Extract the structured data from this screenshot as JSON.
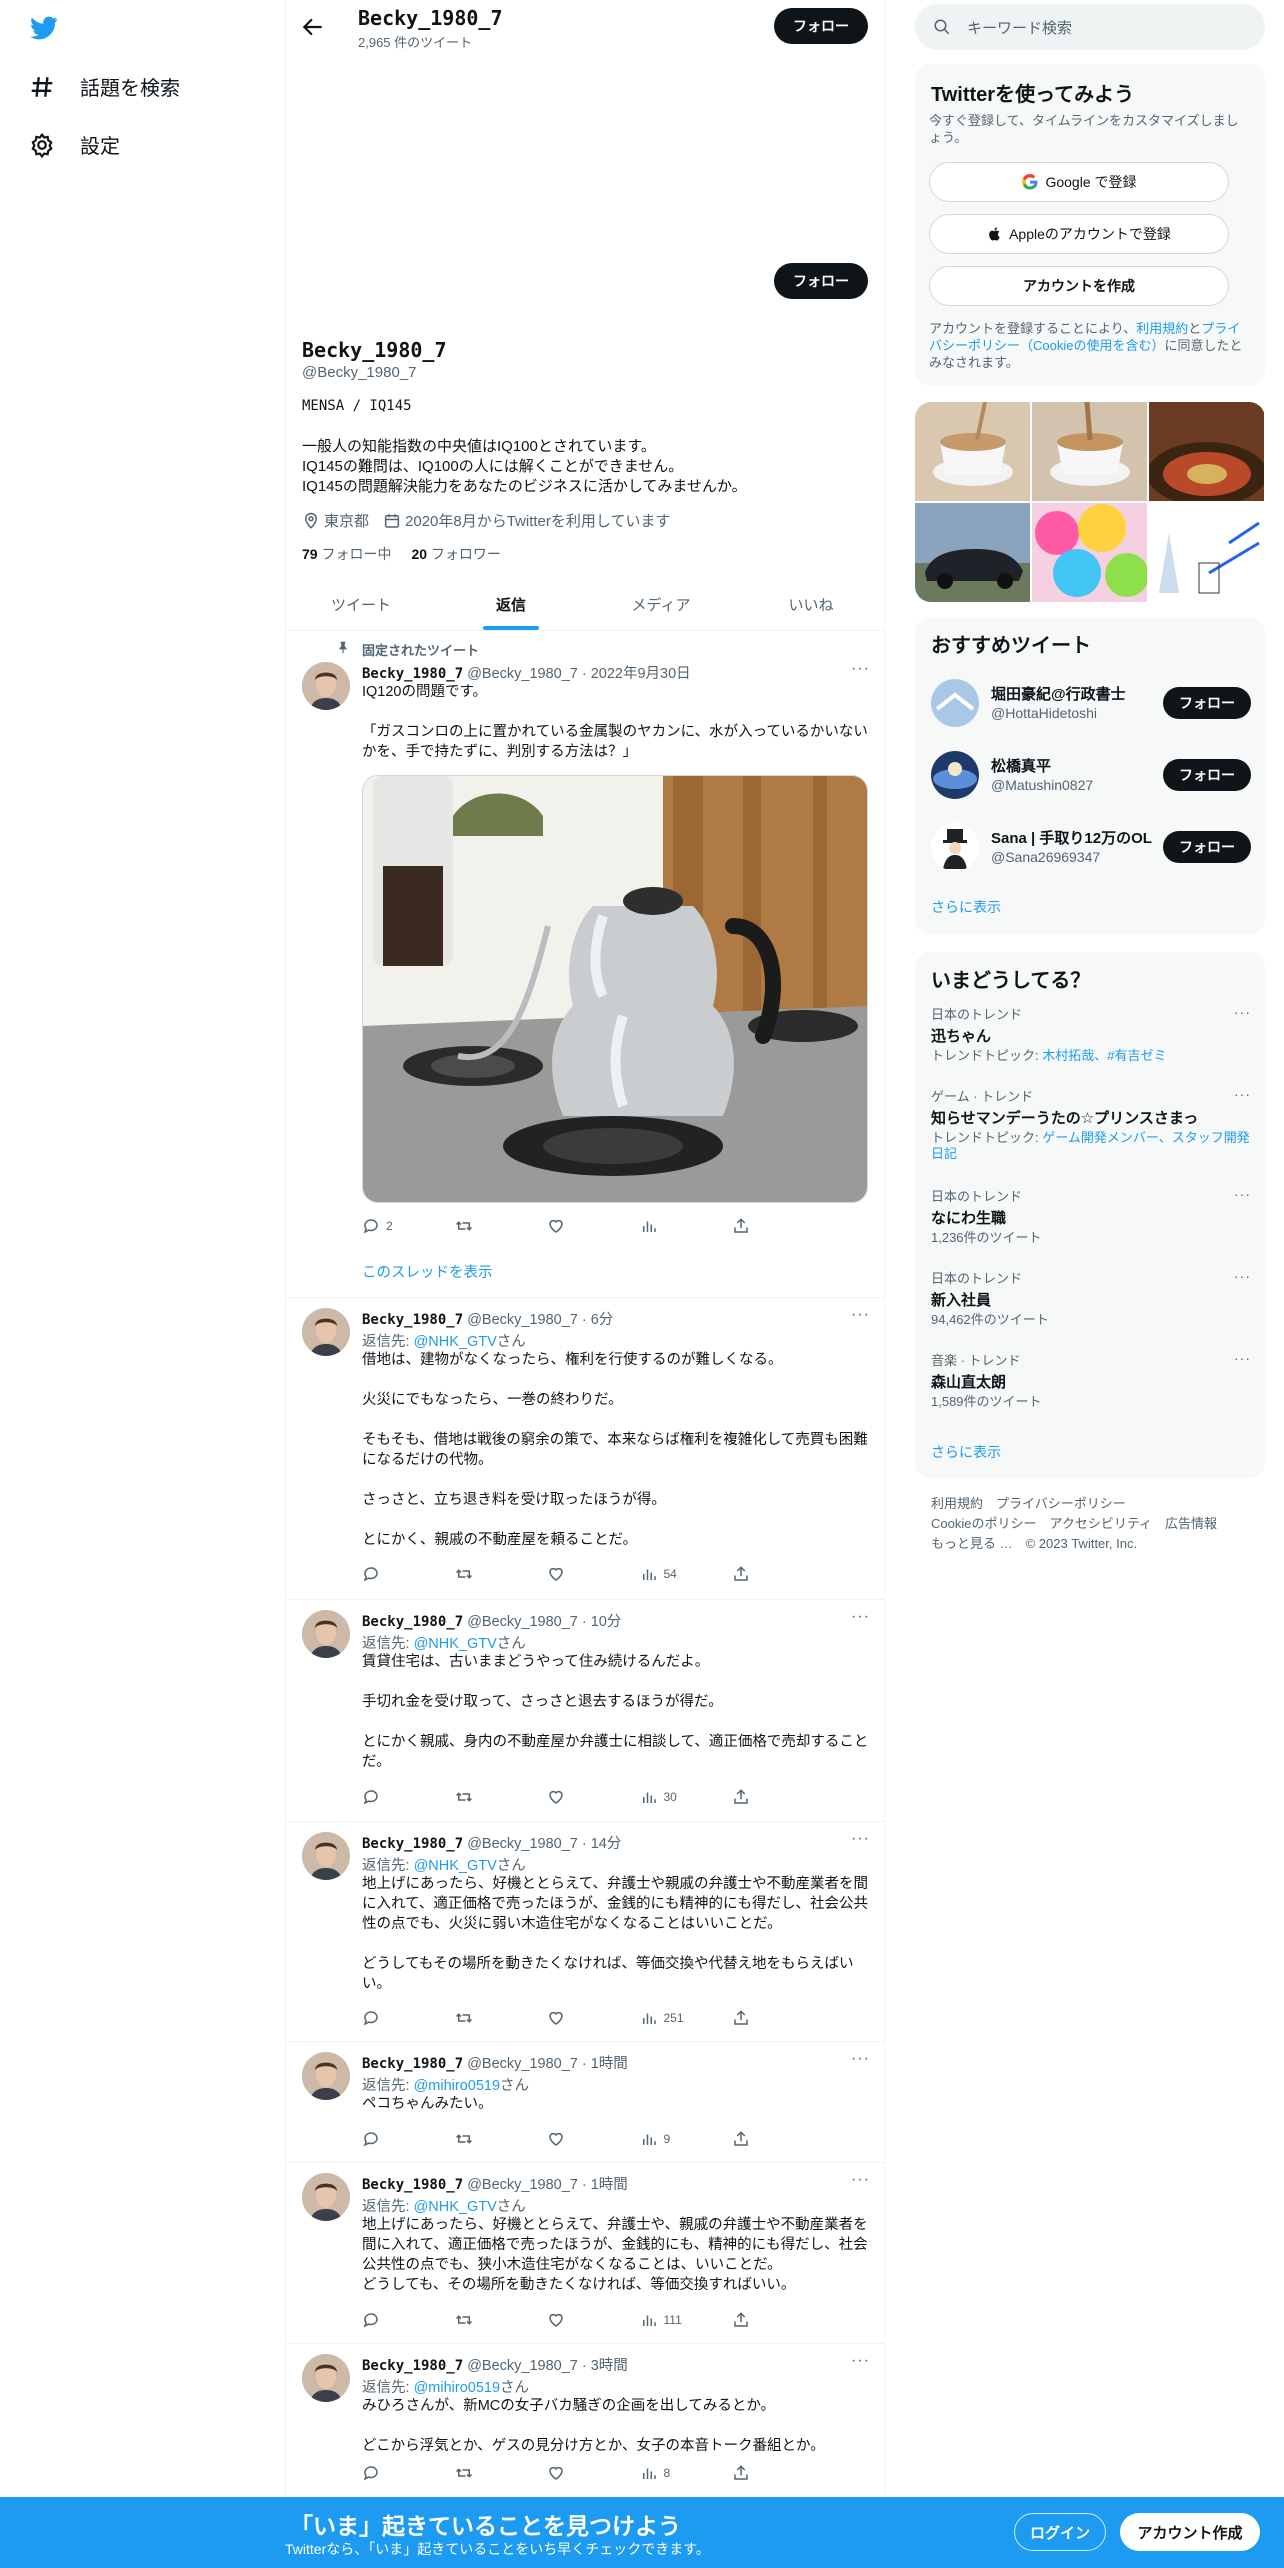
{
  "colors": {
    "accent": "#1d9bf0",
    "text": "#0f1419",
    "secondary": "#536471",
    "button": "#0f1419"
  },
  "nav": {
    "explore": "話題を検索",
    "settings": "設定"
  },
  "topbar": {
    "name": "Becky_1980_7",
    "tweet_count": "2,965 件のツイート",
    "follow": "フォロー"
  },
  "profile": {
    "follow": "フォロー",
    "name": "Becky_1980_7",
    "handle": "@Becky_1980_7",
    "bio_line1": "MENSA / IQ145",
    "bio": "一般人の知能指数の中央値はIQ100とされています。\nIQ145の難問は、IQ100の人には解くことができません。\nIQ145の問題解決能力をあなたのビジネスに活かしてみませんか。",
    "location": "東京都",
    "joined": "2020年8月からTwitterを利用しています",
    "following_count": "79",
    "following_label": "フォロー中",
    "followers_count": "20",
    "followers_label": "フォロワー"
  },
  "tabs": [
    "ツイート",
    "返信",
    "メディア",
    "いいね"
  ],
  "pinned": {
    "label": "固定されたツイート",
    "name": "Becky_1980_7",
    "meta": "@Becky_1980_7 · 2022年9月30日",
    "text1": "IQ120の問題です。",
    "text2": "「ガスコンロの上に置かれている金属製のヤカンに、水が入っているかいないかを、手で持たずに、判別する方法は？」",
    "reply_count": "2",
    "show_thread": "このスレッドを表示"
  },
  "replies": [
    {
      "name": "Becky_1980_7",
      "meta": "@Becky_1980_7 · 6分",
      "reply_to": "@NHK_GTV",
      "san": "さん",
      "text": "借地は、建物がなくなったら、権利を行使するのが難しくなる。\n\n火災にでもなったら、一巻の終わりだ。\n\nそもそも、借地は戦後の窮余の策で、本来ならば権利を複雑化して売買も困難になるだけの代物。\n\nさっさと、立ち退き料を受け取ったほうが得。\n\nとにかく、親戚の不動産屋を頼ることだ。",
      "views": "54"
    },
    {
      "name": "Becky_1980_7",
      "meta": "@Becky_1980_7 · 10分",
      "reply_to": "@NHK_GTV",
      "san": "さん",
      "text": "賃貸住宅は、古いままどうやって住み続けるんだよ。\n\n手切れ金を受け取って、さっさと退去するほうが得だ。\n\nとにかく親戚、身内の不動産屋か弁護士に相談して、適正価格で売却することだ。",
      "views": "30"
    },
    {
      "name": "Becky_1980_7",
      "meta": "@Becky_1980_7 · 14分",
      "reply_to": "@NHK_GTV",
      "san": "さん",
      "text": "地上げにあったら、好機ととらえて、弁護士や親戚の弁護士や不動産業者を間に入れて、適正価格で売ったほうが、金銭的にも精神的にも得だし、社会公共性の点でも、火災に弱い木造住宅がなくなることはいいことだ。\n\nどうしてもその場所を動きたくなければ、等価交換や代替え地をもらえばいい。",
      "views": "251"
    },
    {
      "name": "Becky_1980_7",
      "meta": "@Becky_1980_7 · 1時間",
      "reply_to": "@mihiro0519",
      "san": "さん",
      "text": "ペコちゃんみたい。",
      "views": "9"
    },
    {
      "name": "Becky_1980_7",
      "meta": "@Becky_1980_7 · 1時間",
      "reply_to": "@NHK_GTV",
      "san": "さん",
      "text": "地上げにあったら、好機ととらえて、弁護士や、親戚の弁護士や不動産業者を間に入れて、適正価格で売ったほうが、金銭的にも、精神的にも得だし、社会公共性の点でも、狭小木造住宅がなくなることは、いいことだ。\nどうしても、その場所を動きたくなければ、等価交換すればいい。",
      "views": "111"
    },
    {
      "name": "Becky_1980_7",
      "meta": "@Becky_1980_7 · 3時間",
      "reply_to": "@mihiro0519",
      "san": "さん",
      "text": "みひろさんが、新MCの女子バカ騒ぎの企画を出してみるとか。\n\nどこから浮気とか、ゲスの見分け方とか、女子の本音トーク番組とか。",
      "views": "8"
    }
  ],
  "search": {
    "placeholder": "キーワード検索"
  },
  "signup": {
    "title": "Twitterを使ってみよう",
    "subtitle": "今すぐ登録して、タイムラインをカスタマイズしましょう。",
    "google": "Google で登録",
    "apple": "Appleのアカウントで登録",
    "create": "アカウントを作成",
    "legal_pre": "アカウントを登録することにより、",
    "terms": "利用規約",
    "and": "と",
    "privacy": "プライバシーポリシー（Cookieの使用を含む）",
    "legal_post": "に同意したとみなされます。"
  },
  "recommended": {
    "title": "おすすめツイート",
    "accounts": [
      {
        "name": "堀田豪紀@行政書士",
        "handle": "@HottaHidetoshi",
        "follow": "フォロー"
      },
      {
        "name": "松橋真平",
        "handle": "@Matushin0827",
        "follow": "フォロー"
      },
      {
        "name": "Sana | 手取り12万のOL",
        "handle": "@Sana26969347",
        "follow": "フォロー"
      }
    ],
    "more": "さらに表示"
  },
  "trends": {
    "title": "いまどうしてる？",
    "items": [
      {
        "context": "日本のトレンド",
        "title": "迅ちゃん",
        "sub_pre": "トレンドトピック: ",
        "sub_links": "木村拓哉、#有吉ゼミ"
      },
      {
        "context": "ゲーム · トレンド",
        "title": "知らせマンデーうたの☆プリンスさまっ",
        "sub_pre": "トレンドトピック: ",
        "sub_links": "ゲーム開発メンバー、スタッフ開発日記"
      },
      {
        "context": "日本のトレンド",
        "title": "なにわ生職",
        "sub_pre": "1,236件のツイート",
        "sub_links": ""
      },
      {
        "context": "日本のトレンド",
        "title": "新入社員",
        "sub_pre": "94,462件のツイート",
        "sub_links": ""
      },
      {
        "context": "音楽 · トレンド",
        "title": "森山直太朗",
        "sub_pre": "1,589件のツイート",
        "sub_links": ""
      }
    ],
    "more": "さらに表示"
  },
  "footer": {
    "line1": "利用規約　プライバシーポリシー",
    "line2": "Cookieのポリシー　アクセシビリティ　広告情報",
    "line3": "もっと見る …　© 2023 Twitter, Inc."
  },
  "bottom": {
    "title": "「いま」起きていることを見つけよう",
    "subtitle": "Twitterなら、「いま」起きていることをいち早くチェックできます。",
    "login": "ログイン",
    "signup": "アカウント作成"
  }
}
